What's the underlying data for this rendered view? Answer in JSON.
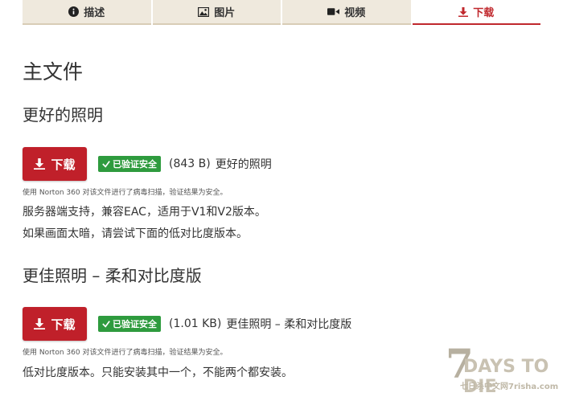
{
  "tabs": [
    {
      "label": "描述",
      "icon": "info-icon",
      "active": false
    },
    {
      "label": "图片",
      "icon": "image-icon",
      "active": false
    },
    {
      "label": "视频",
      "icon": "video-icon",
      "active": false
    },
    {
      "label": "下载",
      "icon": "download-icon",
      "active": true
    }
  ],
  "main": {
    "title": "主文件",
    "sections": [
      {
        "heading": "更好的照明",
        "button_label": "下载",
        "badge": "已验证安全",
        "size": "(843 B)",
        "file_name": "更好的照明",
        "note": "使用 Norton 360 对该文件进行了病毒扫描，验证结果为安全。",
        "desc": [
          "服务器端支持，兼容EAC，适用于V1和V2版本。",
          "如果画面太暗，请尝试下面的低对比度版本。"
        ]
      },
      {
        "heading": "更佳照明 – 柔和对比度版",
        "button_label": "下载",
        "badge": "已验证安全",
        "size": "(1.01 KB)",
        "file_name": "更佳照明 – 柔和对比度版",
        "note": "使用 Norton 360 对该文件进行了病毒扫描，验证结果为安全。",
        "desc": [
          "低对比度版本。只能安装其中一个，不能两个都安装。"
        ]
      }
    ]
  },
  "logo": {
    "seven": "7",
    "days": "DAYS TO DIE",
    "sub": "七日杀中文网7risha.com"
  },
  "colors": {
    "accent": "#c0202a",
    "badge": "#2e9b3e",
    "tab_bg": "#efe9dd"
  }
}
